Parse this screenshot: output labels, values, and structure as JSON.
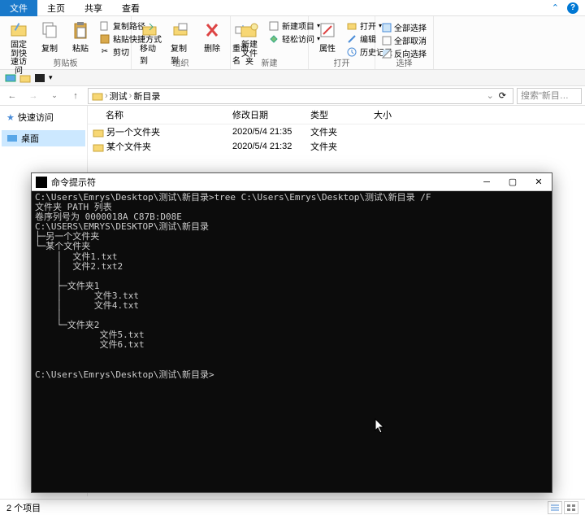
{
  "tabs": {
    "file": "文件",
    "home": "主页",
    "share": "共享",
    "view": "查看"
  },
  "ribbon": {
    "pin": "固定到快\n速访问",
    "copy": "复制",
    "paste": "粘贴",
    "copypath": "复制路径",
    "pasteshortcut": "粘贴快捷方式",
    "cut": "剪切",
    "group_clipboard": "剪贴板",
    "moveto": "移动到",
    "copyto": "复制到",
    "delete": "删除",
    "rename": "重命名",
    "group_organize": "组织",
    "newfolder": "新建\n文件夹",
    "newitem": "新建项目",
    "easyaccess": "轻松访问",
    "group_new": "新建",
    "properties": "属性",
    "open": "打开",
    "edit": "编辑",
    "history": "历史记录",
    "group_open": "打开",
    "selectall": "全部选择",
    "selectnone": "全部取消",
    "invert": "反向选择",
    "group_select": "选择"
  },
  "breadcrumb": {
    "part1": "测试",
    "part2": "新目录"
  },
  "search_placeholder": "搜索\"新目…",
  "sidebar": {
    "quick": "快速访问",
    "desktop": "桌面"
  },
  "columns": {
    "name": "名称",
    "date": "修改日期",
    "type": "类型",
    "size": "大小"
  },
  "rows": [
    {
      "name": "另一个文件夹",
      "date": "2020/5/4 21:35",
      "type": "文件夹"
    },
    {
      "name": "某个文件夹",
      "date": "2020/5/4 21:32",
      "type": "文件夹"
    }
  ],
  "status": "2 个项目",
  "cmd": {
    "title": "命令提示符",
    "lines": [
      "C:\\Users\\Emrys\\Desktop\\测试\\新目录>tree C:\\Users\\Emrys\\Desktop\\测试\\新目录 /F",
      "文件夹 PATH 列表",
      "卷序列号为 0000018A C87B:D08E",
      "C:\\USERS\\EMRYS\\DESKTOP\\测试\\新目录",
      "├─另一个文件夹",
      "└─某个文件夹",
      "    │  文件1.txt",
      "    │  文件2.txt2",
      "    │",
      "    ├─文件夹1",
      "    │      文件3.txt",
      "    │      文件4.txt",
      "    │",
      "    └─文件夹2",
      "            文件5.txt",
      "            文件6.txt",
      "",
      "",
      "C:\\Users\\Emrys\\Desktop\\测试\\新目录>"
    ]
  }
}
